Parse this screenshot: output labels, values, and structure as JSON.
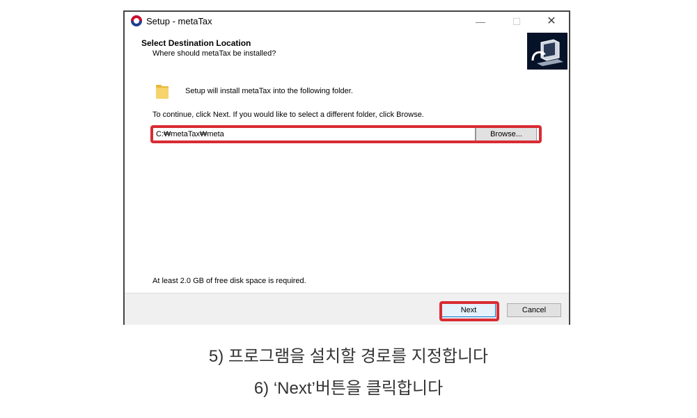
{
  "window": {
    "title": "Setup - metaTax",
    "minimize": "—",
    "maximize": "☐",
    "close": "✕"
  },
  "header": {
    "title": "Select Destination Location",
    "subtitle": "Where should metaTax be installed?"
  },
  "body": {
    "info": "Setup will install metaTax into the following folder.",
    "instruction": "To continue, click Next. If you would like to select a different folder, click Browse.",
    "path_value": "C:₩metaTax₩meta",
    "browse_label": "Browse...",
    "disk_space": "At least 2.0 GB of free disk space is required."
  },
  "footer": {
    "next_label": "Next",
    "cancel_label": "Cancel"
  },
  "captions": {
    "line1": "5) 프로그램을 설치할 경로를 지정합니다",
    "line2": "6) ‘Next’버튼을 클릭합니다"
  },
  "colors": {
    "highlight": "#d92b32",
    "header_image_bg": "#061228",
    "folder": "#f2c94c"
  },
  "icons": {
    "app": "government-emblem-icon",
    "header": "computer-install-icon",
    "folder": "folder-icon"
  }
}
